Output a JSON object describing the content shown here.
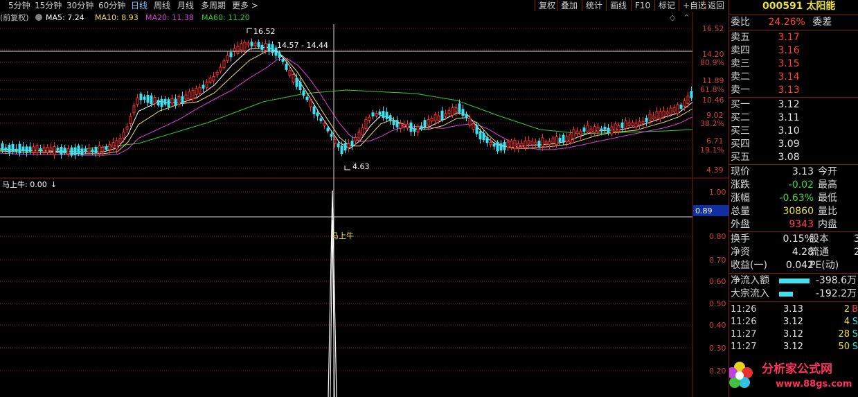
{
  "toolbar": {
    "periods": [
      "5分钟",
      "15分钟",
      "30分钟",
      "60分钟",
      "日线",
      "周线",
      "月线",
      "多周期",
      "更多 >"
    ],
    "active_period": "日线",
    "buttons": [
      "复权",
      "叠加",
      "统计",
      "画线",
      "F10",
      "标记",
      "+自选",
      "返回"
    ]
  },
  "main_legend": {
    "prefix": "(前复权)",
    "ma5": "MA5: 7.24",
    "ma10": "MA10: 8.93",
    "ma20": "MA20: 11.38",
    "ma60": "MA60: 11.20"
  },
  "colors": {
    "up": "#ff3030",
    "down": "#40e0f0",
    "ma5": "#ffffff",
    "ma10": "#f0e060",
    "ma20": "#e040e0",
    "ma60": "#30d030",
    "grid": "#801c1c",
    "axis_text": "#d04040"
  },
  "price_axis": [
    "16.52",
    "14.20",
    "80.9%",
    "11.89",
    "61.8%",
    "10.46",
    "9.02",
    "38.2%",
    "6.71",
    "19.1%",
    "4.39"
  ],
  "annotations": {
    "high": "16.52",
    "range": "14.57 - 14.44",
    "low": "4.63"
  },
  "sub_chart": {
    "legend": "马上牛: 0.00",
    "axis": [
      "1.00",
      "0.80",
      "0.70",
      "0.60",
      "0.50",
      "0.40",
      "0.30",
      "0.20"
    ],
    "cursor_value": "0.89",
    "signal_label": "马上牛"
  },
  "quote": {
    "code": "000591",
    "name": "太阳能",
    "weibi_label": "委比",
    "weibi": "24.26%",
    "weicha_label": "委差",
    "asks": [
      {
        "label": "卖五",
        "price": "3.17"
      },
      {
        "label": "卖四",
        "price": "3.16"
      },
      {
        "label": "卖三",
        "price": "3.15"
      },
      {
        "label": "卖二",
        "price": "3.14"
      },
      {
        "label": "卖一",
        "price": "3.13"
      }
    ],
    "bids": [
      {
        "label": "买一",
        "price": "3.12"
      },
      {
        "label": "买二",
        "price": "3.11"
      },
      {
        "label": "买三",
        "price": "3.10"
      },
      {
        "label": "买四",
        "price": "3.09"
      },
      {
        "label": "买五",
        "price": "3.08"
      }
    ],
    "stats": [
      {
        "l1": "现价",
        "v1": "3.13",
        "l2": "今开",
        "c": "white"
      },
      {
        "l1": "涨跌",
        "v1": "-0.02",
        "l2": "最高",
        "c": "green"
      },
      {
        "l1": "涨幅",
        "v1": "-0.63%",
        "l2": "最低",
        "c": "green"
      },
      {
        "l1": "总量",
        "v1": "30860",
        "l2": "量比",
        "c": "yellow"
      },
      {
        "l1": "外盘",
        "v1": "9343",
        "l2": "内盘",
        "c": "red"
      }
    ],
    "stats2": [
      {
        "l1": "换手",
        "v1": "0.15%",
        "l2": "股本",
        "v2": "3"
      },
      {
        "l1": "净资",
        "v1": "4.28",
        "l2": "流通",
        "v2": "2"
      },
      {
        "l1": "收益(一)",
        "v1": "0.042",
        "l2": "PE(动)",
        "v2": ""
      }
    ],
    "flows": [
      {
        "label": "净流入额",
        "value": "-398.6万",
        "bar": 44
      },
      {
        "label": "大宗流入",
        "value": "-192.2万",
        "bar": 20
      }
    ],
    "ticks": [
      {
        "time": "11:26",
        "price": "3.13",
        "vol": "2",
        "flag": "B"
      },
      {
        "time": "11:26",
        "price": "3.12",
        "vol": "4",
        "flag": "S"
      },
      {
        "time": "11:27",
        "price": "3.12",
        "vol": "28",
        "flag": "S"
      },
      {
        "time": "11:27",
        "price": "3.12",
        "vol": "50",
        "flag": "S"
      }
    ]
  },
  "watermark": {
    "text": "分析家公式网",
    "url": "www.88gs.com"
  }
}
